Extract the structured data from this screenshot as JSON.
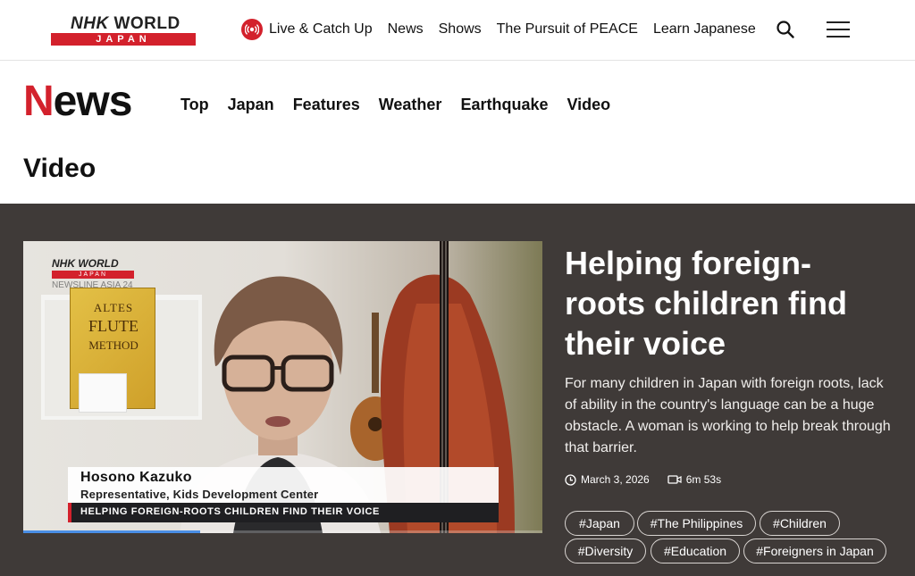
{
  "brand": {
    "line1_bold": "NHK",
    "line1_rest": "WORLD",
    "line2": "JAPAN"
  },
  "top_nav": {
    "live_label": "Live & Catch Up",
    "items": [
      "News",
      "Shows",
      "The Pursuit of PEACE",
      "Learn Japanese"
    ]
  },
  "section": {
    "title_first": "N",
    "title_rest": "ews",
    "nav": [
      "Top",
      "Japan",
      "Features",
      "Weather",
      "Earthquake",
      "Video"
    ]
  },
  "page_title": "Video",
  "feature": {
    "video": {
      "watermark_brand": "NHK WORLD",
      "watermark_sub": "JAPAN",
      "watermark_program": "NEWSLINE ASIA 24",
      "book_line1": "ALTES",
      "book_line2": "FLUTE",
      "book_line3": "METHOD",
      "speaker_name": "Hosono Kazuko",
      "speaker_title": "Representative, Kids Development Center",
      "strap_text": "HELPING FOREIGN-ROOTS CHILDREN FIND THEIR VOICE",
      "progress_fraction": 0.34
    },
    "headline": "Helping foreign-roots children find their voice",
    "summary": "For many children in Japan with foreign roots, lack of ability in the country's language can be a huge obstacle. A woman is working to help break through that barrier.",
    "date": "March 3, 2026",
    "duration": "6m 53s",
    "tags": [
      "#Japan",
      "#The Philippines",
      "#Children",
      "#Diversity",
      "#Education",
      "#Foreigners in Japan"
    ]
  },
  "colors": {
    "accent": "#d3212c",
    "feature_bg": "#3f3a38",
    "progress": "#4a8ee6"
  },
  "icons": [
    "live-broadcast-icon",
    "search-icon",
    "hamburger-menu-icon",
    "clock-icon",
    "video-camera-icon"
  ]
}
